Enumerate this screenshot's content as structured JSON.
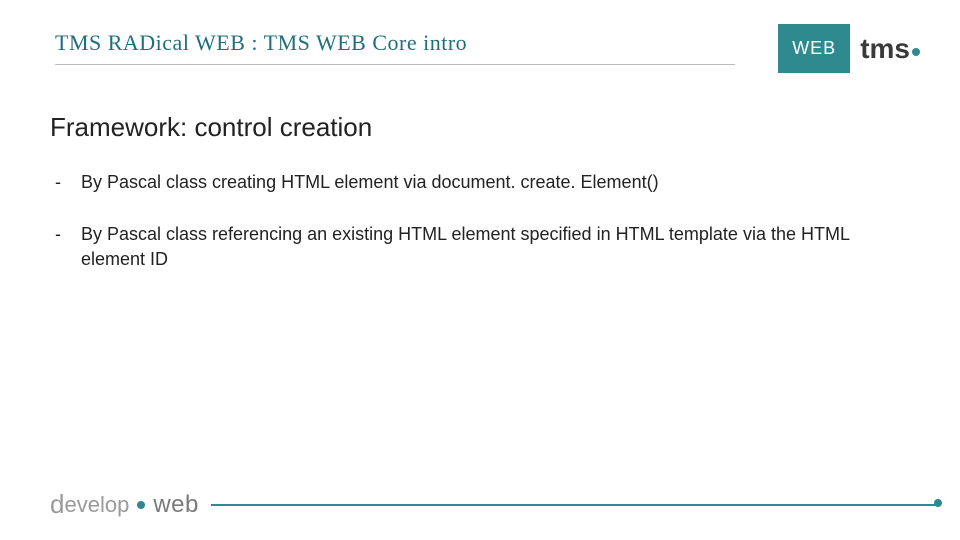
{
  "header": {
    "title": "TMS RADical WEB : TMS WEB Core intro"
  },
  "logo": {
    "web_label": "WEB",
    "brand": "tms"
  },
  "subtitle": "Framework: control creation",
  "bullets": [
    "By Pascal class creating HTML element via document. create. Element()",
    "By Pascal class referencing an existing HTML element specified in HTML template via the HTML element ID"
  ],
  "footer": {
    "brand_first": "d",
    "brand_rest": "evelop",
    "web": "web"
  }
}
